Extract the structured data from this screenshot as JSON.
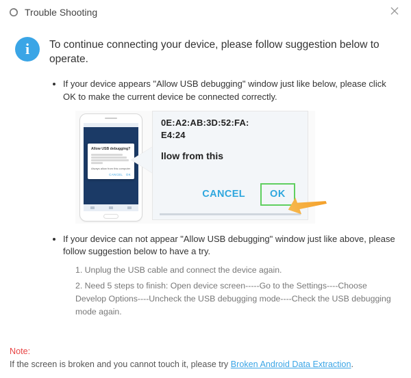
{
  "titlebar": {
    "title": "Trouble Shooting"
  },
  "info_glyph": "i",
  "headline": "To continue connecting your device, please follow suggestion below to operate.",
  "bullet1": "If your device appears \"Allow USB debugging\" window just like below, please click OK to make the current device  be connected correctly.",
  "bullet2": "If your device can not appear \"Allow USB debugging\" window just like above, please follow suggestion below to have a try.",
  "illus": {
    "phone_dialog_title": "Allow USB debugging?",
    "phone_dialog_chk": "Always allow from this computer",
    "phone_btn_cancel": "CANCEL",
    "phone_btn_ok": "OK",
    "zoom_mac_line1": "0E:A2:AB:3D:52:FA:",
    "zoom_mac_line2": "E4:24",
    "zoom_prompt": "llow from this",
    "zoom_cancel": "CANCEL",
    "zoom_ok": "OK"
  },
  "steps": {
    "s1": "1. Unplug the USB cable and connect the device again.",
    "s2": "2. Need 5 steps to finish: Open device screen-----Go to the Settings----Choose Develop Options----Uncheck the USB debugging mode----Check the USB debugging mode again."
  },
  "note": {
    "label": "Note:",
    "text": "If the screen is broken and you cannot touch it, please try ",
    "link": "Broken Android Data Extraction",
    "tail": "."
  }
}
